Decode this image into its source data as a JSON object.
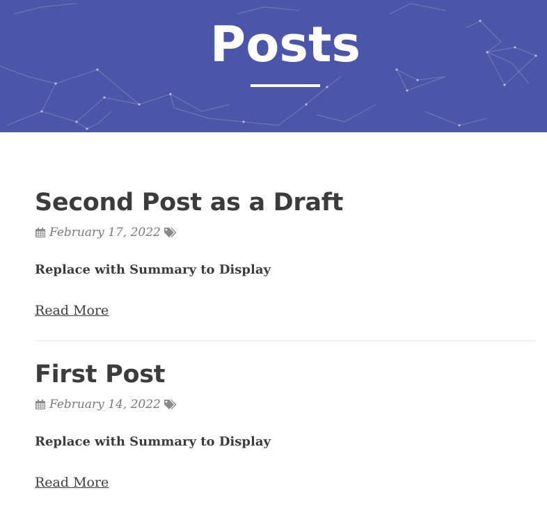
{
  "header": {
    "title": "Posts",
    "background_color": "#4b56a8"
  },
  "posts": [
    {
      "title": "Second Post as a Draft",
      "date": "February 17, 2022",
      "summary": "Replace with Summary to Display",
      "read_more_label": "Read More",
      "date_icon": "calendar-icon",
      "tags_icon": "tags-icon"
    },
    {
      "title": "First Post",
      "date": "February 14, 2022",
      "summary": "Replace with Summary to Display",
      "read_more_label": "Read More",
      "date_icon": "calendar-icon",
      "tags_icon": "tags-icon"
    }
  ]
}
